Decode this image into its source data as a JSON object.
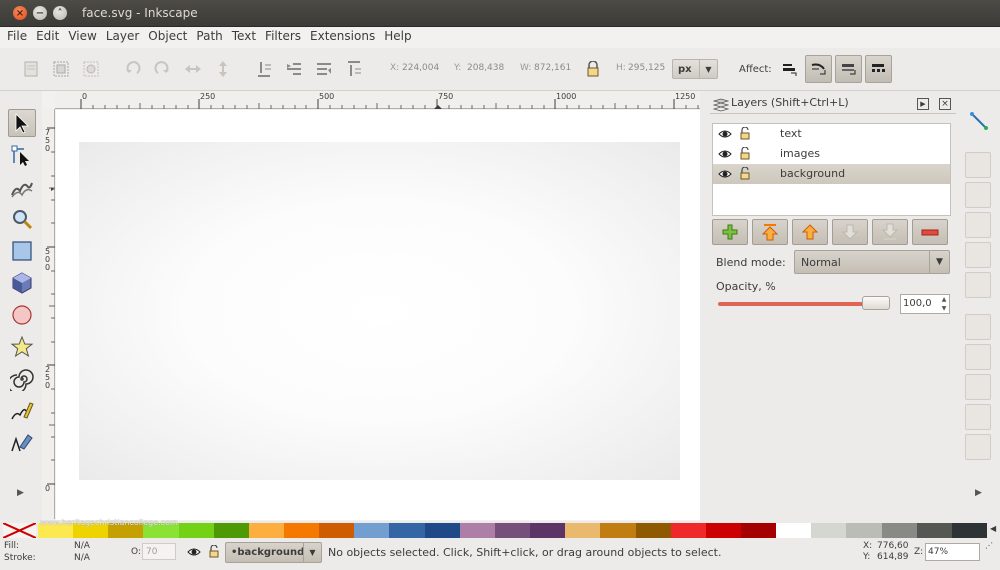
{
  "window": {
    "title": "face.svg - Inkscape",
    "close_glyph": "×",
    "min_glyph": "−",
    "max_glyph": "˄"
  },
  "menu": [
    "File",
    "Edit",
    "View",
    "Layer",
    "Object",
    "Path",
    "Text",
    "Filters",
    "Extensions",
    "Help"
  ],
  "toolbar": {
    "x_label": "X:",
    "x_value": "224,004",
    "y_label": "Y:",
    "y_value": "208,438",
    "w_label": "W:",
    "w_value": "872,161",
    "h_label": "H:",
    "h_value": "295,125",
    "unit": "px",
    "affect_label": "Affect:"
  },
  "rulers": {
    "h_ticks": [
      "0",
      "250",
      "500",
      "750",
      "1000",
      "1250"
    ],
    "v_ticks": [
      "750",
      "500",
      "250",
      "0"
    ]
  },
  "layers_panel": {
    "title": "Layers (Shift+Ctrl+L)",
    "layers": [
      {
        "name": "text",
        "selected": false
      },
      {
        "name": "images",
        "selected": false
      },
      {
        "name": "background",
        "selected": true
      }
    ],
    "blend_label": "Blend mode:",
    "blend_value": "Normal",
    "opacity_label": "Opacity, %",
    "opacity_value": "100,0",
    "opacity_fraction": 1.0
  },
  "palette": {
    "colors": [
      "#fce94f",
      "#edd400",
      "#c4a000",
      "#8ae234",
      "#73d216",
      "#4e9a06",
      "#fcaf3e",
      "#f57900",
      "#ce5c00",
      "#729fcf",
      "#3465a4",
      "#204a87",
      "#ad7fa8",
      "#75507b",
      "#5c3566",
      "#e9b96e",
      "#c17d11",
      "#8f5902",
      "#ef2929",
      "#cc0000",
      "#a40000",
      "#ffffff",
      "#d3d7cf",
      "#babdb6",
      "#888a85",
      "#555753",
      "#2e3436"
    ],
    "watermark": "www.heritagechristiancollege.com"
  },
  "status": {
    "fill_label": "Fill:",
    "fill_value": "N/A",
    "stroke_label": "Stroke:",
    "stroke_value": "N/A",
    "opacity_label": "O:",
    "opacity_value": "70",
    "current_layer": "•background",
    "message": "No objects selected. Click, Shift+click, or drag around objects to select.",
    "x_label": "X:",
    "x_value": "776,60",
    "y_label": "Y:",
    "y_value": "614,89",
    "zoom_label": "Z:",
    "zoom_value": "47%"
  },
  "icons": {
    "toolbox": [
      "selector-arrow-icon",
      "node-editor-icon",
      "tweak-icon",
      "zoom-icon",
      "rectangle-icon",
      "3d-box-icon",
      "ellipse-icon",
      "star-icon",
      "spiral-icon",
      "pencil-icon",
      "pen-icon"
    ]
  }
}
